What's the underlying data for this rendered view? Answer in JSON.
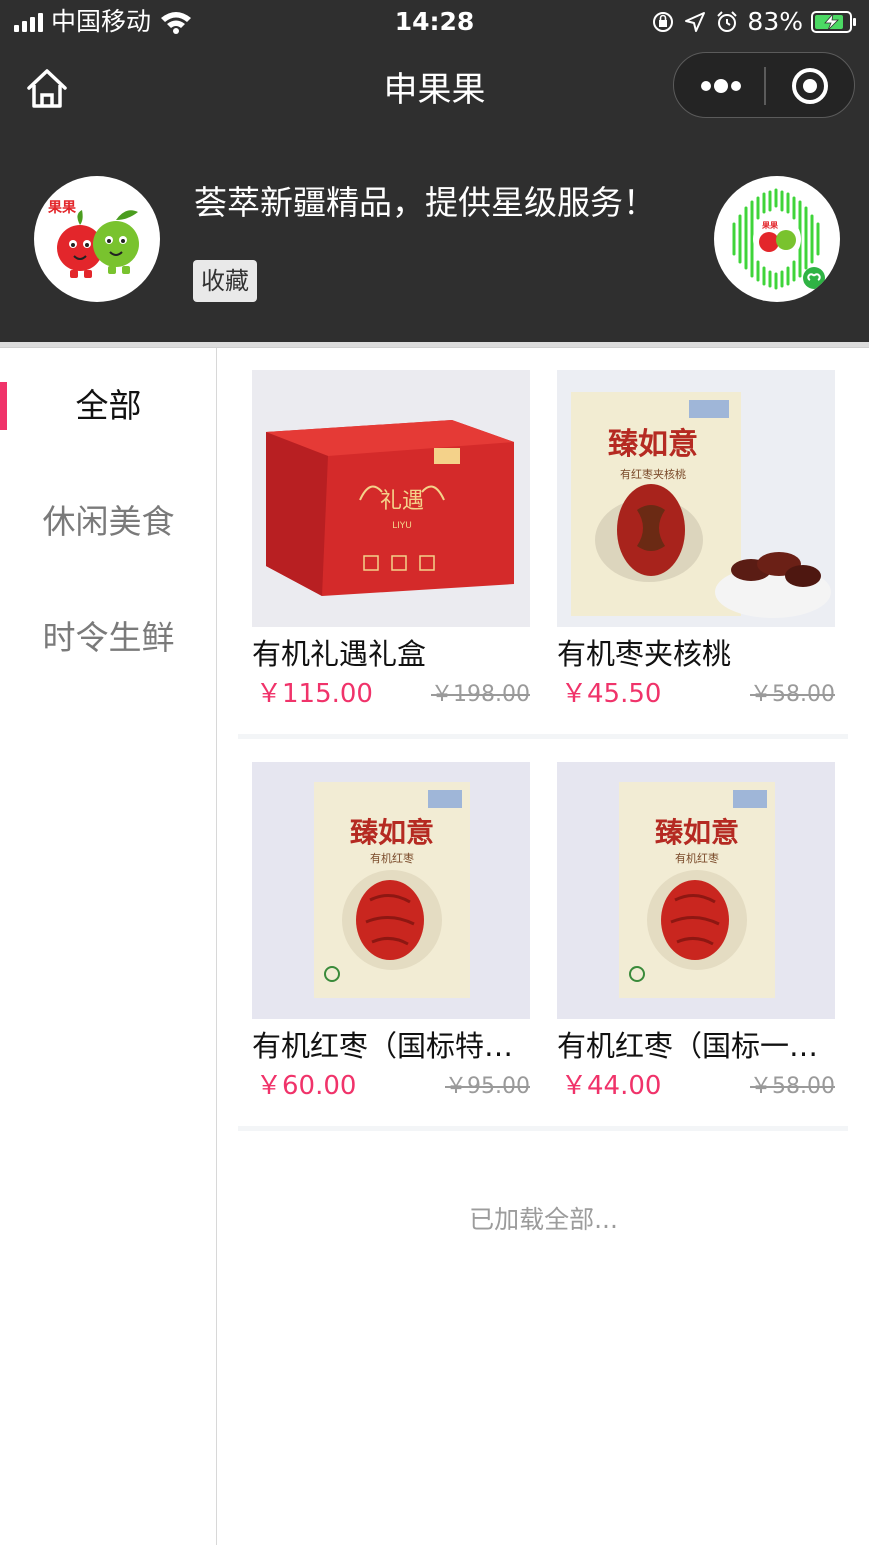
{
  "status_bar": {
    "carrier": "中国移动",
    "time": "14:28",
    "battery": "83%"
  },
  "nav": {
    "title": "申果果"
  },
  "header": {
    "slogan": "荟萃新疆精品，提供星级服务！",
    "favorite_label": "收藏",
    "logo_text": "果果"
  },
  "sidebar": {
    "items": [
      {
        "label": "全部",
        "active": true
      },
      {
        "label": "休闲美食",
        "active": false
      },
      {
        "label": "时令生鲜",
        "active": false
      }
    ]
  },
  "products": [
    {
      "name": "有机礼遇礼盒",
      "price": "￥115.00",
      "original_price": "￥198.00",
      "image_text": "礼遇",
      "image_subtext": "LIYU"
    },
    {
      "name": "有机枣夹核桃",
      "price": "￥45.50",
      "original_price": "￥58.00",
      "image_text": "臻如意",
      "image_subtext": "有红枣夹核桃"
    },
    {
      "name": "有机红枣（国标特…",
      "price": "￥60.00",
      "original_price": "￥95.00",
      "image_text": "臻如意",
      "image_subtext": "有机红枣"
    },
    {
      "name": "有机红枣（国标一…",
      "price": "￥44.00",
      "original_price": "￥58.00",
      "image_text": "臻如意",
      "image_subtext": "有机红枣"
    }
  ],
  "footer": {
    "load_all_text": "已加载全部..."
  },
  "colors": {
    "accent": "#f0336a",
    "bar_bg": "#2f2f2f",
    "muted_text": "#9c9c9c"
  }
}
